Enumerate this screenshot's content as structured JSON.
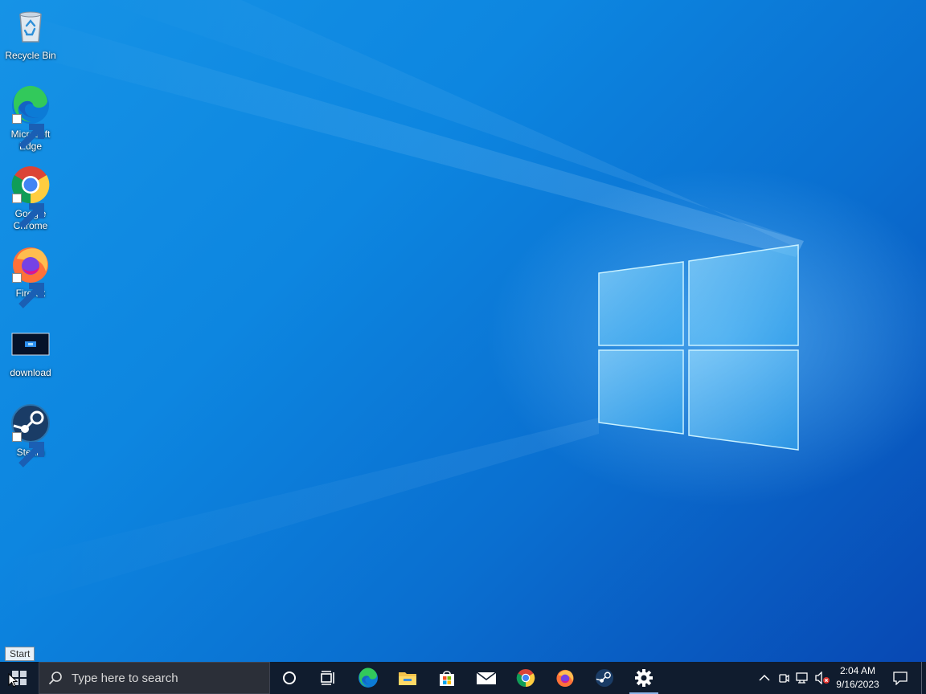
{
  "desktop": {
    "icons": [
      {
        "label": "Recycle Bin",
        "icon": "recycle-bin-icon"
      },
      {
        "label": "Microsoft Edge",
        "icon": "edge-icon"
      },
      {
        "label": "Google Chrome",
        "icon": "chrome-icon"
      },
      {
        "label": "Firefox",
        "icon": "firefox-icon"
      },
      {
        "label": "download",
        "icon": "image-file-icon"
      },
      {
        "label": "Steam",
        "icon": "steam-icon"
      }
    ]
  },
  "taskbar": {
    "start_tooltip": "Start",
    "search_placeholder": "Type here to search",
    "pinned": [
      "cortana-icon",
      "task-view-icon",
      "edge-icon",
      "file-explorer-icon",
      "store-icon",
      "mail-icon",
      "chrome-icon",
      "firefox-icon",
      "steam-icon",
      "settings-icon"
    ],
    "active_app": "settings-icon",
    "tray": {
      "icons": [
        "chevron-up-icon",
        "meet-now-icon",
        "network-icon",
        "volume-muted-icon"
      ],
      "time": "2:04 AM",
      "date": "9/16/2023",
      "notification_icon": "action-center-icon"
    }
  },
  "colors": {
    "taskbar": "#101c2e",
    "desktop_accent": "#0a78d6"
  }
}
